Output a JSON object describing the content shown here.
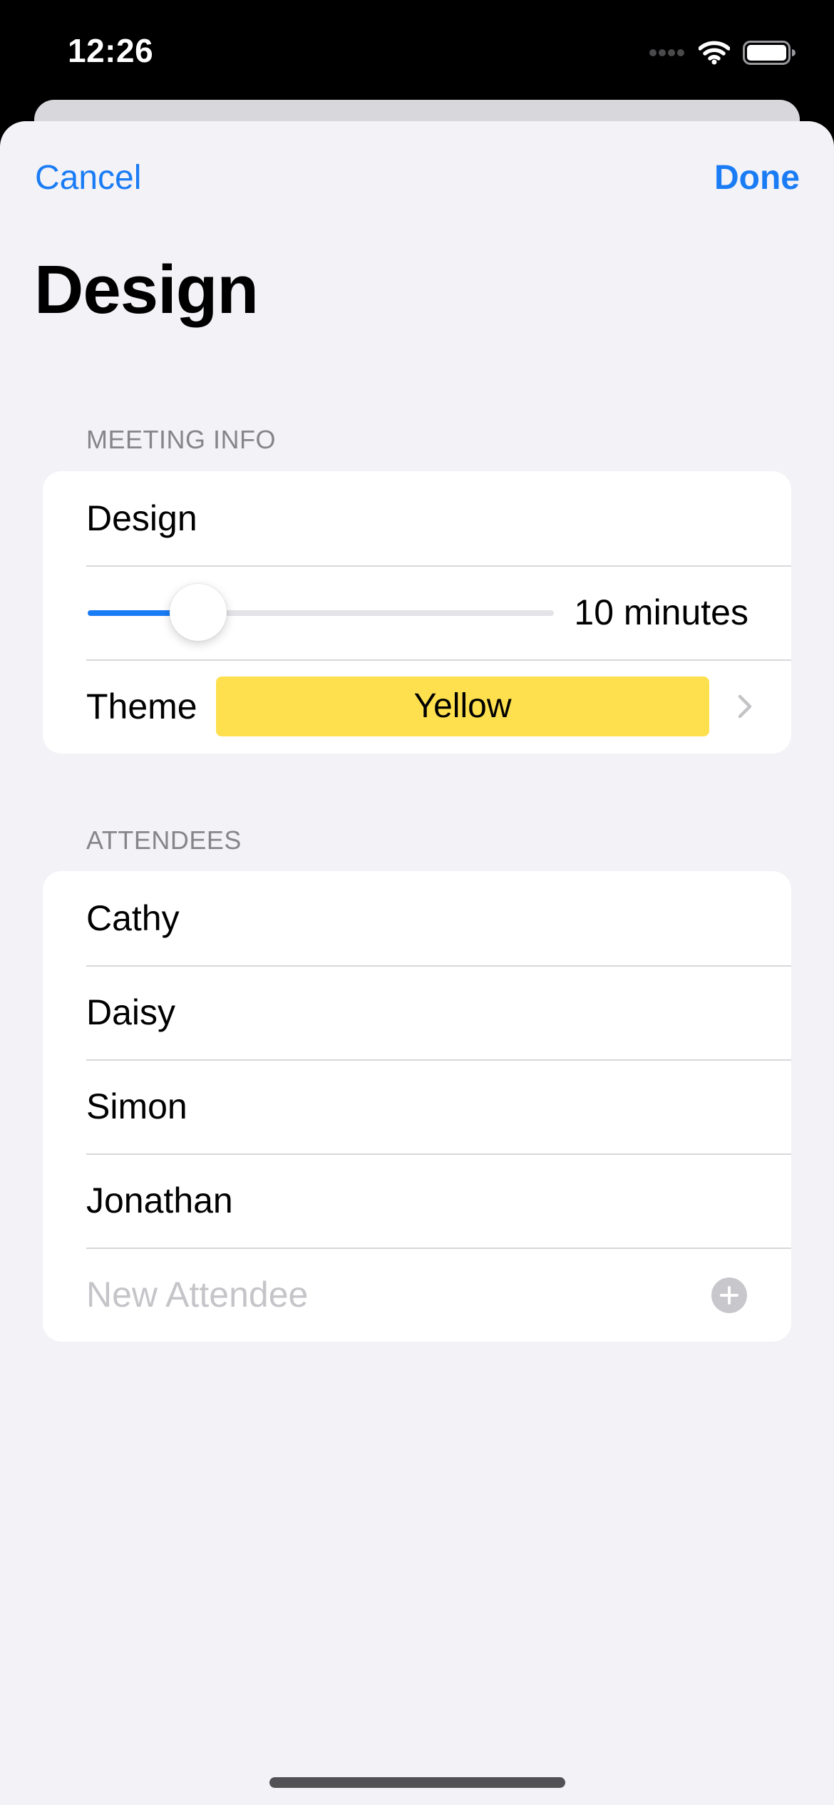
{
  "status_bar": {
    "time": "12:26"
  },
  "nav": {
    "cancel_label": "Cancel",
    "done_label": "Done"
  },
  "page": {
    "title": "Design"
  },
  "meeting_info": {
    "header": "MEETING INFO",
    "title_value": "Design",
    "length_minutes": 10,
    "length_label": "10 minutes",
    "slider_min": 5,
    "slider_max": 30,
    "theme_label": "Theme",
    "theme_value": "Yellow",
    "theme_color": "#fee04e"
  },
  "attendees": {
    "header": "ATTENDEES",
    "items": [
      "Cathy",
      "Daisy",
      "Simon",
      "Jonathan"
    ],
    "new_placeholder": "New Attendee"
  },
  "colors": {
    "accent": "#1a7cf5",
    "background": "#f2f2f7"
  },
  "icons": {
    "wifi": "wifi-icon",
    "battery": "battery-icon",
    "cellular": "cellular-dots-icon",
    "chevron": "chevron-right-icon",
    "add": "plus-circle-icon"
  }
}
